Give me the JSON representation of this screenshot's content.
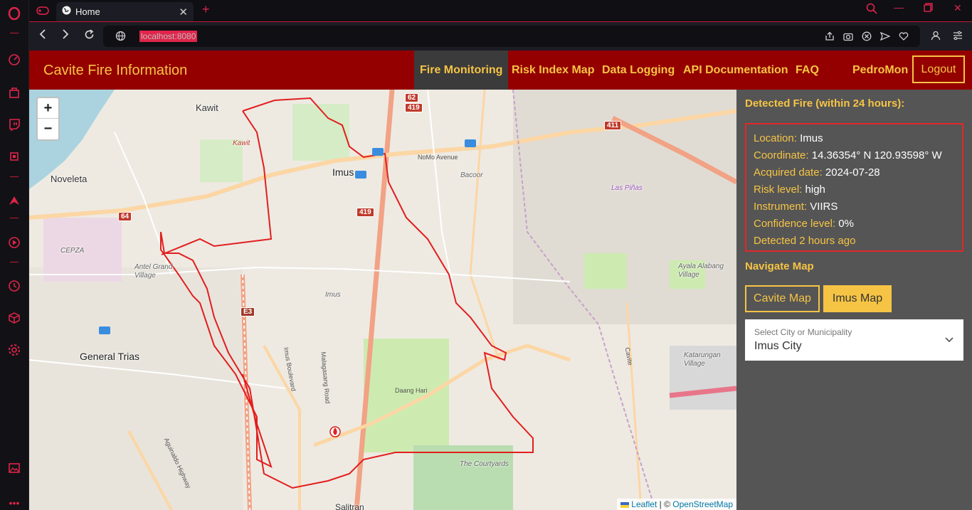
{
  "browser": {
    "tab": {
      "title": "Home",
      "icon": "globe-icon"
    },
    "address": {
      "url": "localhost:8080"
    },
    "sidebar_icons": [
      "opera-logo-icon",
      "speed-dial-icon",
      "shopping-icon",
      "twitch-icon",
      "ai-chip-icon",
      "aria-icon",
      "player-icon",
      "history-icon",
      "extensions-cube-icon",
      "settings-gear-icon",
      "gallery-icon",
      "more-icon"
    ]
  },
  "app": {
    "brand": "Cavite Fire Information",
    "nav": [
      {
        "label": "Fire Monitoring",
        "active": true
      },
      {
        "label": "Risk Index Map"
      },
      {
        "label": "Data Logging"
      },
      {
        "label": "API Documentation"
      },
      {
        "label": "FAQ"
      }
    ],
    "user": "PedroMon",
    "logout": "Logout",
    "colors": {
      "header_bg": "#940000",
      "accent": "#f6c445",
      "panel_bg": "#555555",
      "alert_border": "#e02828"
    }
  },
  "map": {
    "zoom_in": "+",
    "zoom_out": "−",
    "labels": {
      "kawit": "Kawit",
      "kawit2": "Kawit",
      "noveleta": "Noveleta",
      "imus": "Imus",
      "imus2": "Imus",
      "bacoor": "Bacoor",
      "las_pinas": "Las Piñas",
      "cepza": "CEPZA",
      "antel": "Antel Grand Village",
      "general_trias": "General Trias",
      "ayala": "Ayala Alabang Village",
      "katarungan": "Katarungan Village",
      "courtyards": "The Courtyards",
      "salitran": "Salitran",
      "cavite": "Cavite",
      "nomo": "NoMo Avenue",
      "daang_hari": "Daang Hari",
      "imus_blvd": "Imus Boulevard",
      "malagasang": "Malagasang Road",
      "aguinaldo": "Aguinaldo Highway"
    },
    "shields": {
      "s62": "62",
      "s419a": "419",
      "s419b": "419",
      "s411": "411",
      "s64": "64",
      "e3": "E3"
    },
    "attribution": {
      "leaflet": "Leaflet",
      "sep": " | © ",
      "osm": "OpenStreetMap"
    }
  },
  "panel": {
    "detected_heading": "Detected Fire (within 24 hours):",
    "fire": [
      {
        "label": "Location:",
        "value": "Imus"
      },
      {
        "label": "Coordinate:",
        "value": "14.36354° N 120.93598° W"
      },
      {
        "label": "Acquired date:",
        "value": "2024-07-28"
      },
      {
        "label": "Risk level:",
        "value": "high"
      },
      {
        "label": "Instrument:",
        "value": "VIIRS"
      },
      {
        "label": "Confidence level:",
        "value": "0%"
      },
      {
        "label": "Detected 2 hours ago",
        "value": ""
      }
    ],
    "navigate_heading": "Navigate Map",
    "cavite_map_btn": "Cavite Map",
    "imus_map_btn": "Imus Map",
    "select": {
      "label": "Select City or Municipality",
      "value": "Imus City"
    }
  }
}
